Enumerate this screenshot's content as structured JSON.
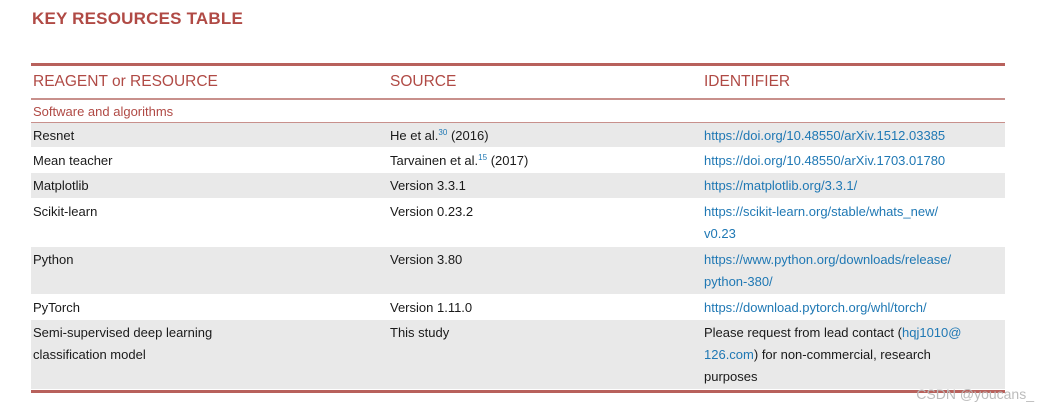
{
  "title": "KEY RESOURCES TABLE",
  "headers": {
    "col1": "REAGENT or RESOURCE",
    "col2": "SOURCE",
    "col3": "IDENTIFIER"
  },
  "section": "Software and algorithms",
  "rows": [
    {
      "resource": "Resnet",
      "source": "He et al.",
      "source_ref": "30",
      "source_year": " (2016)",
      "identifier": "https://doi.org/10.48550/arXiv.1512.03385"
    },
    {
      "resource": "Mean teacher",
      "source": "Tarvainen et al.",
      "source_ref": "15",
      "source_year": " (2017)",
      "identifier": "https://doi.org/10.48550/arXiv.1703.01780"
    },
    {
      "resource": "Matplotlib",
      "source": "Version 3.3.1",
      "identifier": "https://matplotlib.org/3.3.1/"
    },
    {
      "resource": "Scikit-learn",
      "source": "Version 0.23.2",
      "identifier_line1": "https://scikit-learn.org/stable/whats_new/",
      "identifier_line2": "v0.23"
    },
    {
      "resource": "Python",
      "source": "Version 3.80",
      "identifier_line1": "https://www.python.org/downloads/release/",
      "identifier_line2": "python-380/"
    },
    {
      "resource": "PyTorch",
      "source": "Version 1.11.0",
      "identifier": "https://download.pytorch.org/whl/torch/"
    },
    {
      "resource_line1": "Semi-supervised deep learning",
      "resource_line2": "classification model",
      "source": "This study",
      "contact_pre": "Please request from lead contact (",
      "contact_email1": "hqj1010@",
      "contact_email2": "126.com",
      "contact_post": ") for non-commercial, research",
      "contact_line3": "purposes"
    }
  ],
  "watermark": "CSDN @youcans_"
}
